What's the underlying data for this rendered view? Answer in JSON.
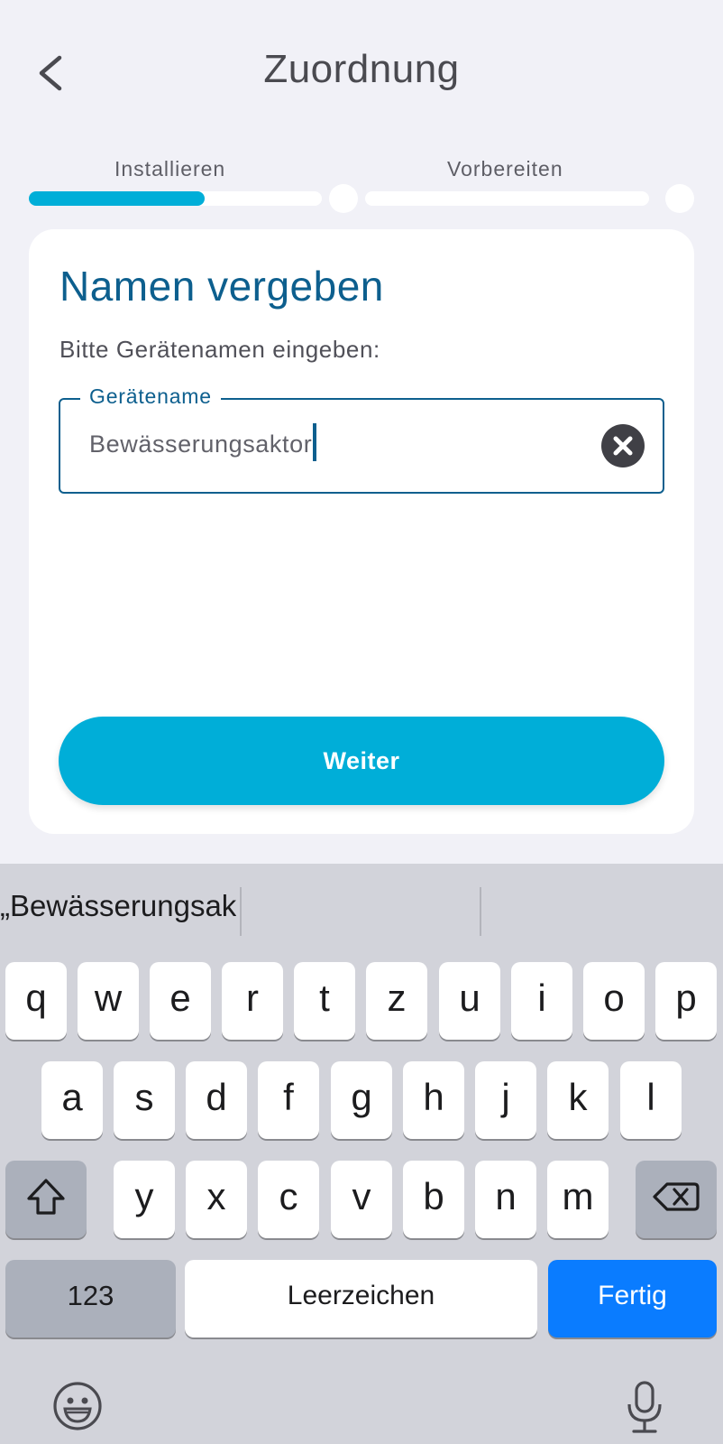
{
  "header": {
    "title": "Zuordnung",
    "back_icon": "chevron-left-icon"
  },
  "steps": {
    "items": [
      {
        "label": "Installieren",
        "progress": 0.6,
        "active": true
      },
      {
        "label": "Vorbereiten",
        "progress": 0.0,
        "active": false
      }
    ],
    "accent_color": "#00aed8"
  },
  "card": {
    "title": "Namen vergeben",
    "subtitle": "Bitte Gerätenamen eingeben:",
    "field": {
      "label": "Gerätename",
      "value": "Bewässerungsaktor",
      "clear_icon": "clear-circle-icon"
    },
    "button_label": "Weiter",
    "title_color": "#0d5f8e"
  },
  "keyboard": {
    "suggestion": "„Bewässerungsaktor“",
    "row1": [
      "q",
      "w",
      "e",
      "r",
      "t",
      "z",
      "u",
      "i",
      "o",
      "p"
    ],
    "row2": [
      "a",
      "s",
      "d",
      "f",
      "g",
      "h",
      "j",
      "k",
      "l"
    ],
    "row3": [
      "y",
      "x",
      "c",
      "v",
      "b",
      "n",
      "m"
    ],
    "numbers_label": "123",
    "space_label": "Leerzeichen",
    "done_label": "Fertig",
    "shift_icon": "shift-icon",
    "delete_icon": "backspace-icon",
    "emoji_icon": "emoji-icon",
    "mic_icon": "microphone-icon",
    "done_color": "#0a7cff"
  }
}
